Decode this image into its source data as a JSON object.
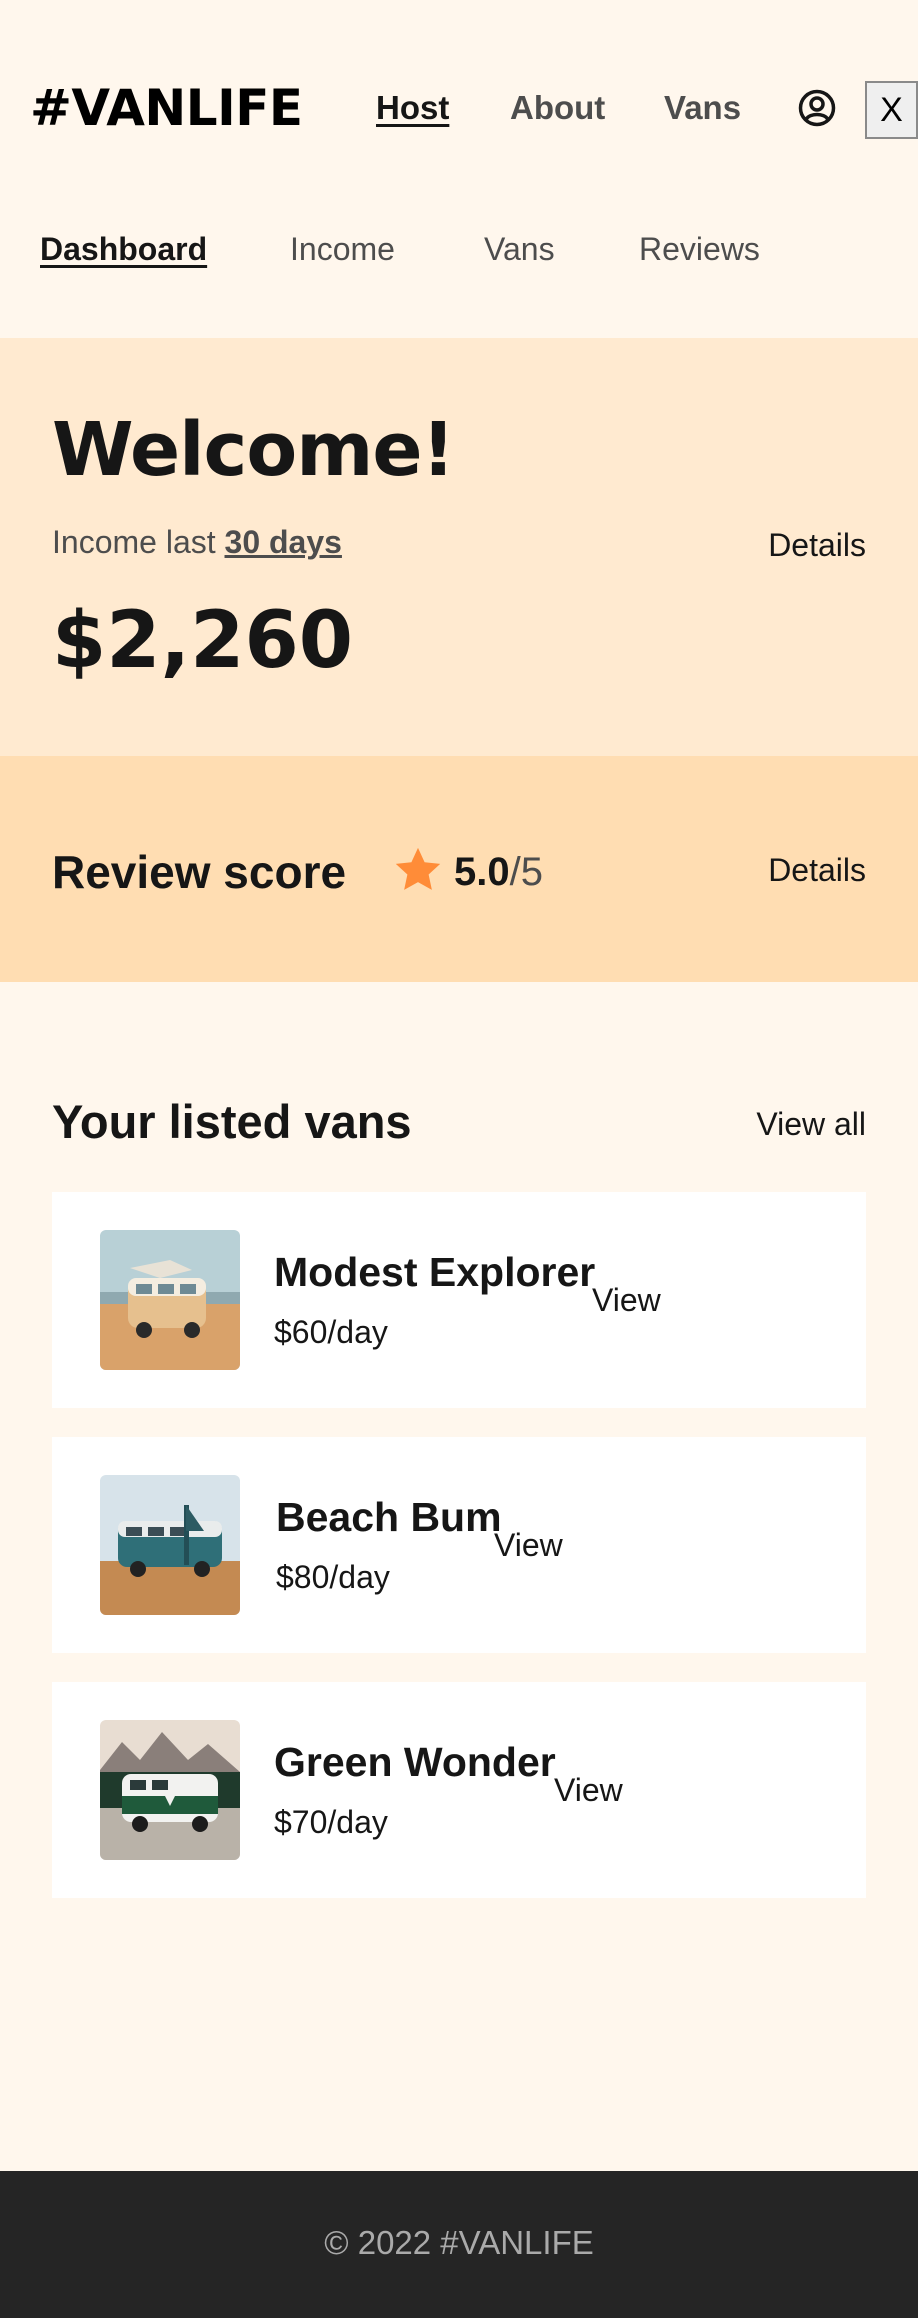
{
  "header": {
    "logo": "#VANLIFE",
    "nav": [
      {
        "label": "Host",
        "active": true
      },
      {
        "label": "About",
        "active": false
      },
      {
        "label": "Vans",
        "active": false
      }
    ],
    "user_icon": "user-circle-icon",
    "close_label": "X"
  },
  "host_nav": [
    {
      "label": "Dashboard",
      "active": true
    },
    {
      "label": "Income",
      "active": false
    },
    {
      "label": "Vans",
      "active": false
    },
    {
      "label": "Reviews",
      "active": false
    }
  ],
  "welcome": {
    "title": "Welcome!",
    "income_prefix": "Income last",
    "income_period": "30 days",
    "details_label": "Details",
    "amount": "$2,260"
  },
  "review": {
    "title": "Review score",
    "star_icon": "star-icon",
    "score": "5.0",
    "out_of": "/5",
    "details_label": "Details"
  },
  "listed": {
    "title": "Your listed vans",
    "view_all_label": "View all",
    "vans": [
      {
        "name": "Modest Explorer",
        "price": "$60/day",
        "view_label": "View"
      },
      {
        "name": "Beach Bum",
        "price": "$80/day",
        "view_label": "View"
      },
      {
        "name": "Green Wonder",
        "price": "$70/day",
        "view_label": "View"
      }
    ]
  },
  "colors": {
    "background": "#fff7ed",
    "welcome_bg": "#ffead0",
    "review_bg": "#ffddb2",
    "star": "#ff8c38",
    "footer_bg": "#252525"
  },
  "footer": {
    "text": "© 2022 #VANLIFE"
  }
}
